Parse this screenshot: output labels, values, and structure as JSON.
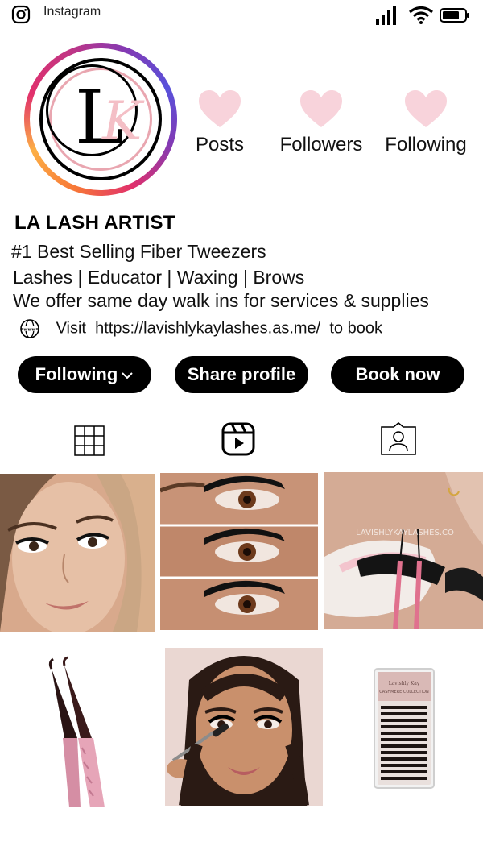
{
  "status_bar": {
    "app_name": "Instagram"
  },
  "profile": {
    "avatar_logo": "LK",
    "username": "LA LASH ARTIST",
    "stats": [
      {
        "label": "Posts",
        "icon": "heart-icon"
      },
      {
        "label": "Followers",
        "icon": "heart-icon"
      },
      {
        "label": "Following",
        "icon": "heart-icon"
      }
    ],
    "bio": [
      "#1 Best Selling Fiber Tweezers",
      "Lashes | Educator | Waxing | Brows",
      "We offer same day walk ins for services & supplies"
    ],
    "link": {
      "prefix": "Visit",
      "url": "https://lavishlykaylashes.as.me/",
      "suffix": "to book"
    }
  },
  "actions": {
    "following_label": "Following",
    "share_label": "Share profile",
    "book_label": "Book now"
  },
  "tabs": [
    {
      "name": "grid",
      "icon": "grid-icon"
    },
    {
      "name": "reels",
      "icon": "reels-icon"
    },
    {
      "name": "tagged",
      "icon": "tagged-icon"
    }
  ],
  "posts": {
    "watermark": "LAVISHLYKAYLASHES.CO",
    "box_label": "Lavishly Kay\nCASHMERE COLLECTION"
  },
  "colors": {
    "heart": "#f8d3db",
    "button_bg": "#000000",
    "button_text": "#ffffff"
  }
}
